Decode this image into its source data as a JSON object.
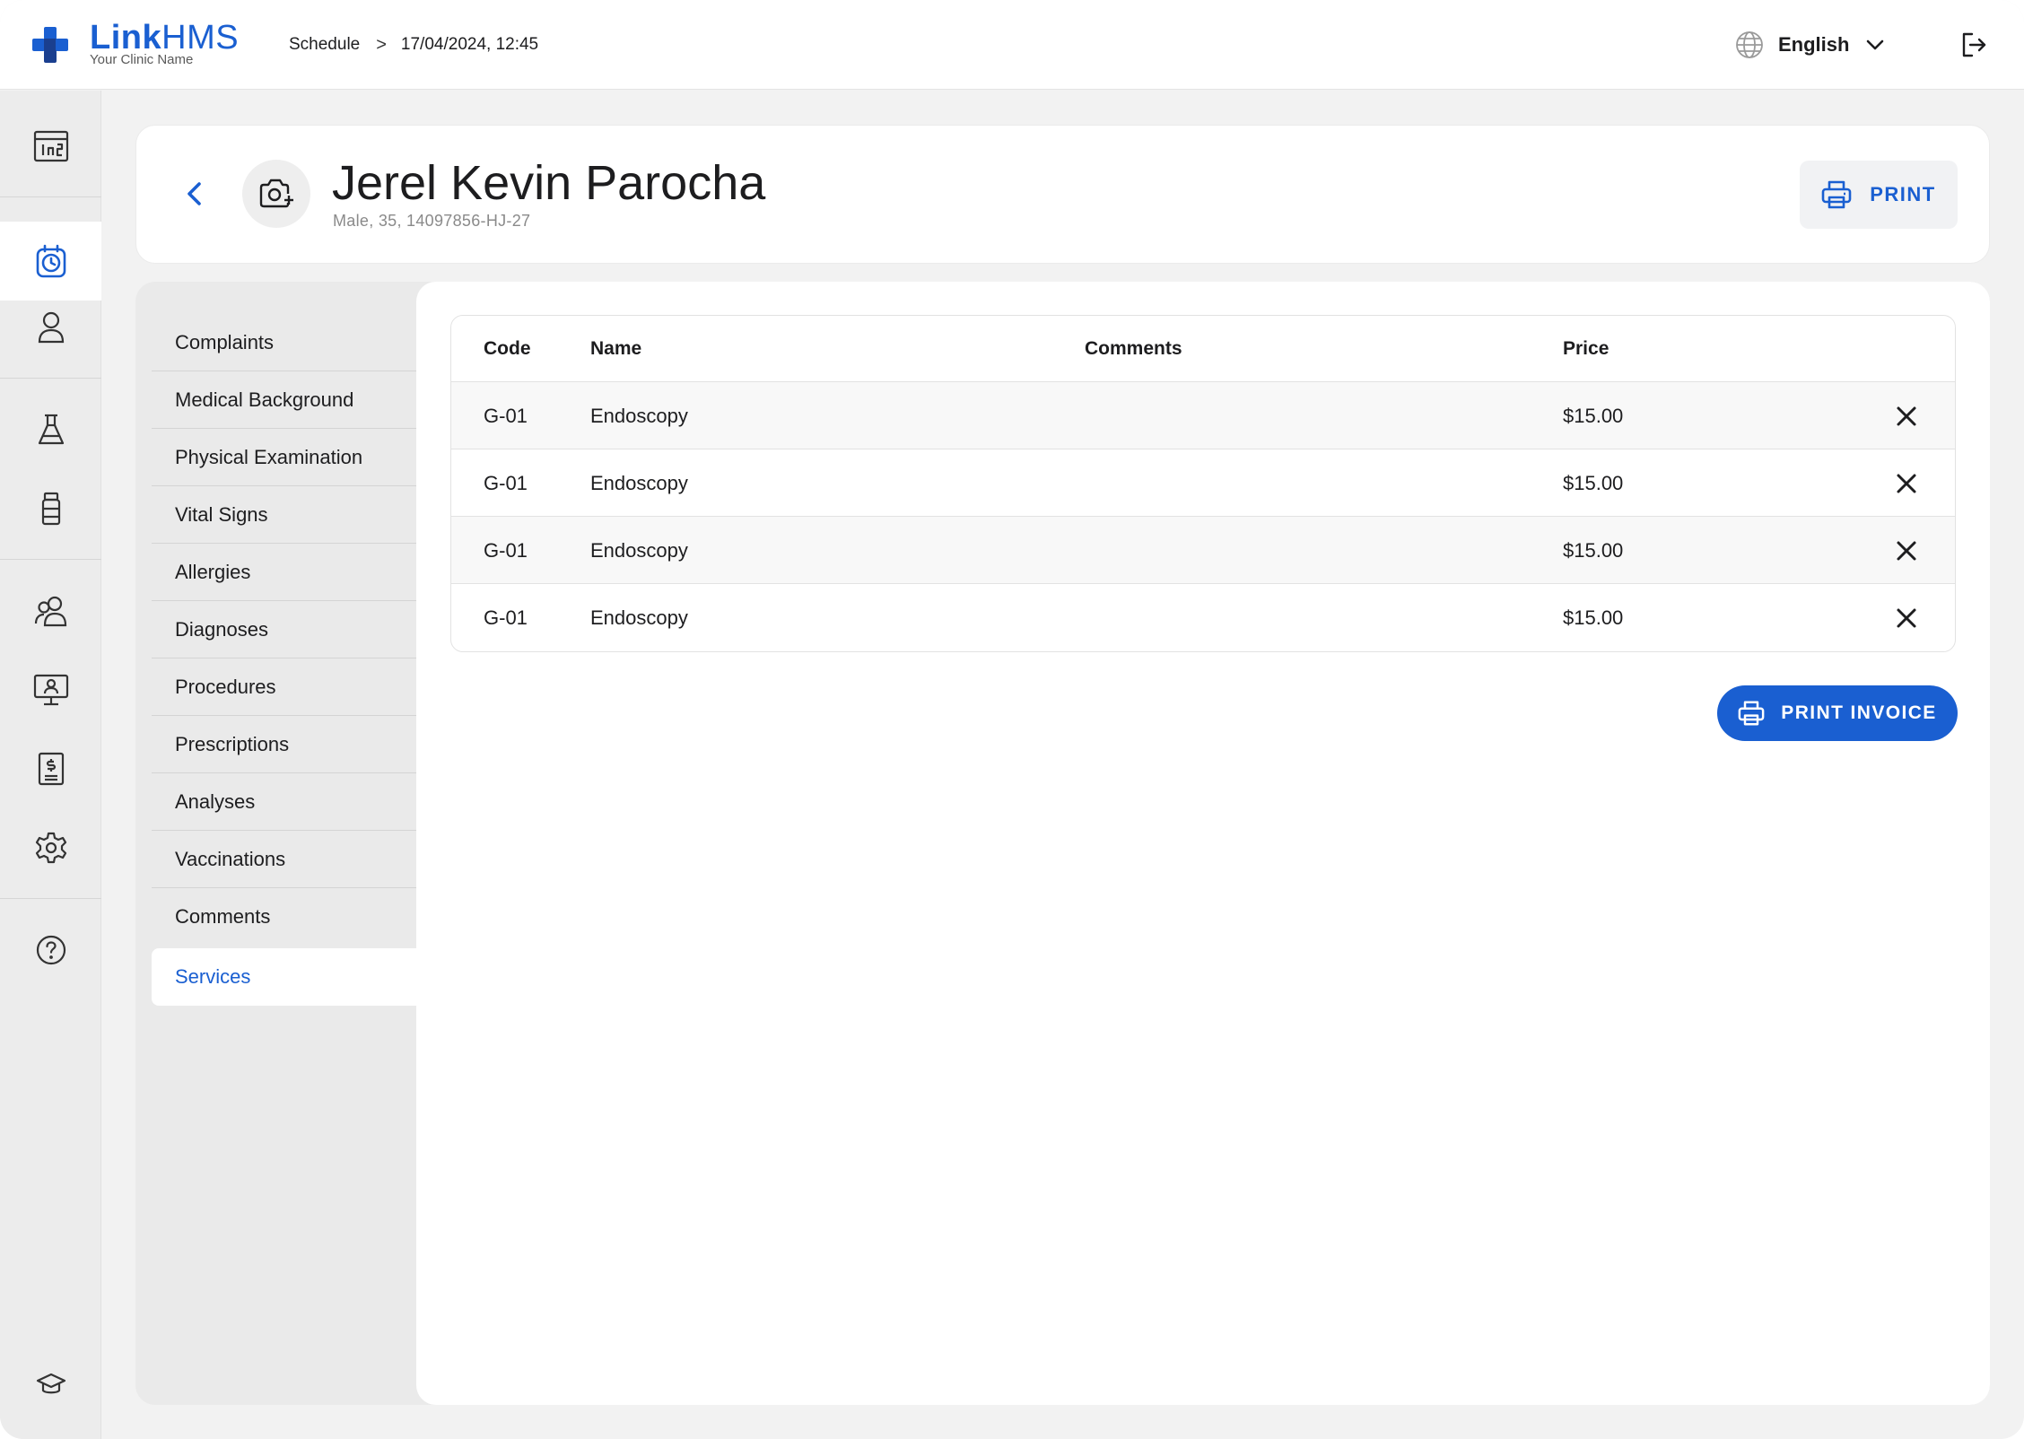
{
  "brand": {
    "name_bold": "Link",
    "name_rest": "HMS",
    "subtitle": "Your Clinic Name",
    "accent": "#1a5fd1"
  },
  "breadcrumb": {
    "section": "Schedule",
    "separator": ">",
    "current": "17/04/2024, 12:45"
  },
  "language": {
    "label": "English",
    "icon": "globe-icon"
  },
  "rail": {
    "items": [
      {
        "icon": "dashboard-icon",
        "active": false
      },
      {
        "icon": "schedule-clock-icon",
        "active": true
      },
      {
        "icon": "person-icon",
        "active": false
      },
      {
        "icon": "lab-flask-icon",
        "active": false
      },
      {
        "icon": "medicine-bottle-icon",
        "active": false
      },
      {
        "icon": "staff-group-icon",
        "active": false
      },
      {
        "icon": "monitor-doctor-icon",
        "active": false
      },
      {
        "icon": "billing-document-icon",
        "active": false
      },
      {
        "icon": "settings-gear-icon",
        "active": false
      },
      {
        "icon": "help-icon",
        "active": false
      },
      {
        "icon": "education-cap-icon",
        "active": false
      }
    ]
  },
  "patient": {
    "name": "Jerel Kevin Parocha",
    "meta": "Male, 35, 14097856-HJ-27"
  },
  "header": {
    "print_label": "PRINT"
  },
  "menu": {
    "items": [
      {
        "label": "Complaints"
      },
      {
        "label": "Medical Background"
      },
      {
        "label": "Physical Examination"
      },
      {
        "label": "Vital Signs"
      },
      {
        "label": "Allergies"
      },
      {
        "label": "Diagnoses"
      },
      {
        "label": "Procedures"
      },
      {
        "label": "Prescriptions"
      },
      {
        "label": "Analyses"
      },
      {
        "label": "Vaccinations"
      },
      {
        "label": "Comments"
      },
      {
        "label": "Services"
      }
    ],
    "active": "Services"
  },
  "services_table": {
    "columns": [
      "Code",
      "Name",
      "Comments",
      "Price"
    ],
    "rows": [
      {
        "code": "G-01",
        "name": "Endoscopy",
        "comments": "",
        "price": "$15.00"
      },
      {
        "code": "G-01",
        "name": "Endoscopy",
        "comments": "",
        "price": "$15.00"
      },
      {
        "code": "G-01",
        "name": "Endoscopy",
        "comments": "",
        "price": "$15.00"
      },
      {
        "code": "G-01",
        "name": "Endoscopy",
        "comments": "",
        "price": "$15.00"
      }
    ]
  },
  "actions": {
    "print_invoice_label": "PRINT INVOICE"
  }
}
